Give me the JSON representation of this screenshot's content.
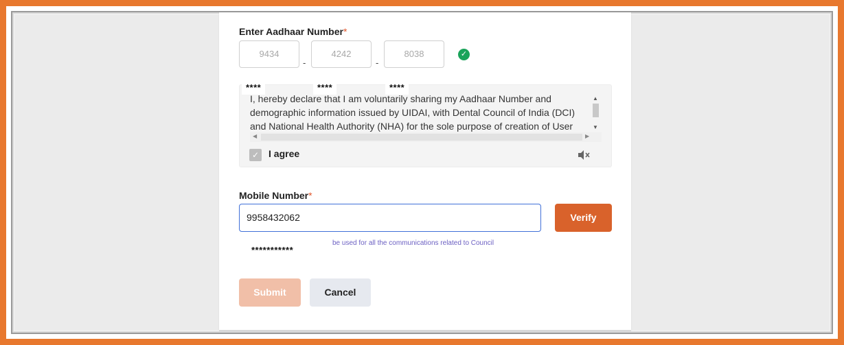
{
  "aadhaar": {
    "label": "Enter Aadhaar Number",
    "required_mark": "*",
    "segments": [
      "9434",
      "4242",
      "8038"
    ],
    "separator": "-",
    "masked": [
      "****",
      "****",
      "****"
    ],
    "verified_icon": "check-circle-icon"
  },
  "consent": {
    "text": "I, hereby declare that I am voluntarily sharing my Aadhaar Number and demographic information issued by UIDAI, with Dental Council of India (DCI) and National Health Authority (NHA) for the sole purpose of creation of User",
    "agree_label": "I agree",
    "agree_checked": true,
    "audio_icon": "speaker-muted-icon"
  },
  "mobile": {
    "label": "Mobile Number",
    "required_mark": "*",
    "value": "9958432062",
    "verify_label": "Verify",
    "hint": "be used for all the communications related to Council",
    "masked": "***********"
  },
  "actions": {
    "submit_label": "Submit",
    "cancel_label": "Cancel"
  },
  "colors": {
    "frame": "#e8782e",
    "primary": "#d9622b",
    "primary_disabled": "#f1bfa8",
    "focus": "#3f6fd8",
    "success": "#1aa35a",
    "hint": "#6b5fc2"
  }
}
